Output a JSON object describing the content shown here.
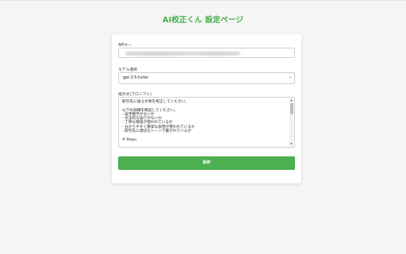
{
  "page": {
    "title": "AI校正くん 設定ページ"
  },
  "form": {
    "api_key": {
      "label": "APIキー",
      "value": "sk-••••••••••••••••••••••••••••••••"
    },
    "model": {
      "label": "モデル選択",
      "selected": "gpt-3.5-turbo"
    },
    "prompt": {
      "label": "指示文(プロンプト)",
      "lines": [
        "取引先に送る文章を校正してください。",
        "",
        "以下の詳細を確認してください。",
        "- 誤字脱字がないか",
        "- 文法的な誤りがないか",
        "- 丁寧な敬語が使われているか",
        "- 分かりやすく簡潔な表現が使われているか",
        "- 取引先に適切なトーンで書かれているか",
        "",
        "# Steps"
      ]
    },
    "save_label": "保存"
  },
  "colors": {
    "accent": "#4caf50",
    "title": "#3fae45",
    "background": "#f5f5f5"
  }
}
